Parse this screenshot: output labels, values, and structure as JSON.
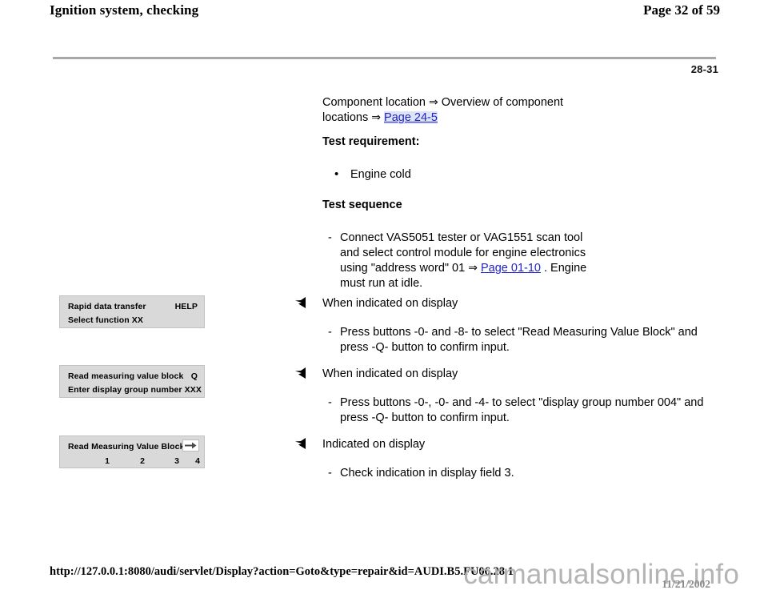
{
  "header": {
    "doc_title": "Ignition system, checking",
    "page_count": "Page 32 of 59",
    "section_number": "28-31"
  },
  "main": {
    "component_location": {
      "text_1": "Component location ",
      "arrow_1": "⇒",
      "text_2": " Overview of component locations ",
      "arrow_2": "⇒",
      "link_label": "Page 24-5"
    },
    "test_requirement": {
      "heading": "Test requirement:",
      "bullets": [
        {
          "marker": "•",
          "text": "Engine cold"
        }
      ]
    },
    "test_sequence": {
      "heading": "Test sequence",
      "step": {
        "dash": "-",
        "text_1": "Connect VAS5051 tester or VAG1551 scan tool and select control module for engine electronics using \"address word\" 01 ",
        "arrow": "⇒",
        "link_label": "Page 01-10",
        "text_2": " . Engine must run at idle."
      }
    },
    "steps": [
      {
        "marker_icon": "left-triangle-marker",
        "title": "When indicated on display",
        "dash": "-",
        "detail": "Press buttons -0- and -8- to select \"Read Measuring Value Block\" and press -Q- button to confirm input."
      },
      {
        "marker_icon": "left-triangle-marker",
        "title": "When indicated on display",
        "dash": "-",
        "detail": "Press buttons -0-, -0- and -4- to select \"display group number 004\" and press -Q- button to confirm input."
      },
      {
        "marker_icon": "left-triangle-marker",
        "title": "Indicated on display",
        "dash": "-",
        "detail": "Check indication in display field 3."
      }
    ],
    "display_boxes": [
      {
        "line1_left": "Rapid data transfer",
        "line1_right": "HELP",
        "line2_left": "Select function XX"
      },
      {
        "line1_left": "Read measuring value block",
        "line1_right": "Q",
        "line2_left": "Enter display group number XXX"
      },
      {
        "line1_left": "Read Measuring Value Block 4",
        "line1_right_icon": "right-arrow-key",
        "fields": [
          "1",
          "2",
          "3",
          "4"
        ]
      }
    ]
  },
  "footer": {
    "url": "http://127.0.0.1:8080/audi/servlet/Display?action=Goto&type=repair&id=AUDI.B5.FU06.28.1",
    "watermark": "carmanualsonline.info",
    "date": "11/21/2002"
  },
  "colors": {
    "link": "#2222cc",
    "link_highlight": "#dde4f4",
    "rule": "#a8a8a8",
    "display_box_bg": "#d9d9d9",
    "watermark": "#b0b0b0"
  }
}
